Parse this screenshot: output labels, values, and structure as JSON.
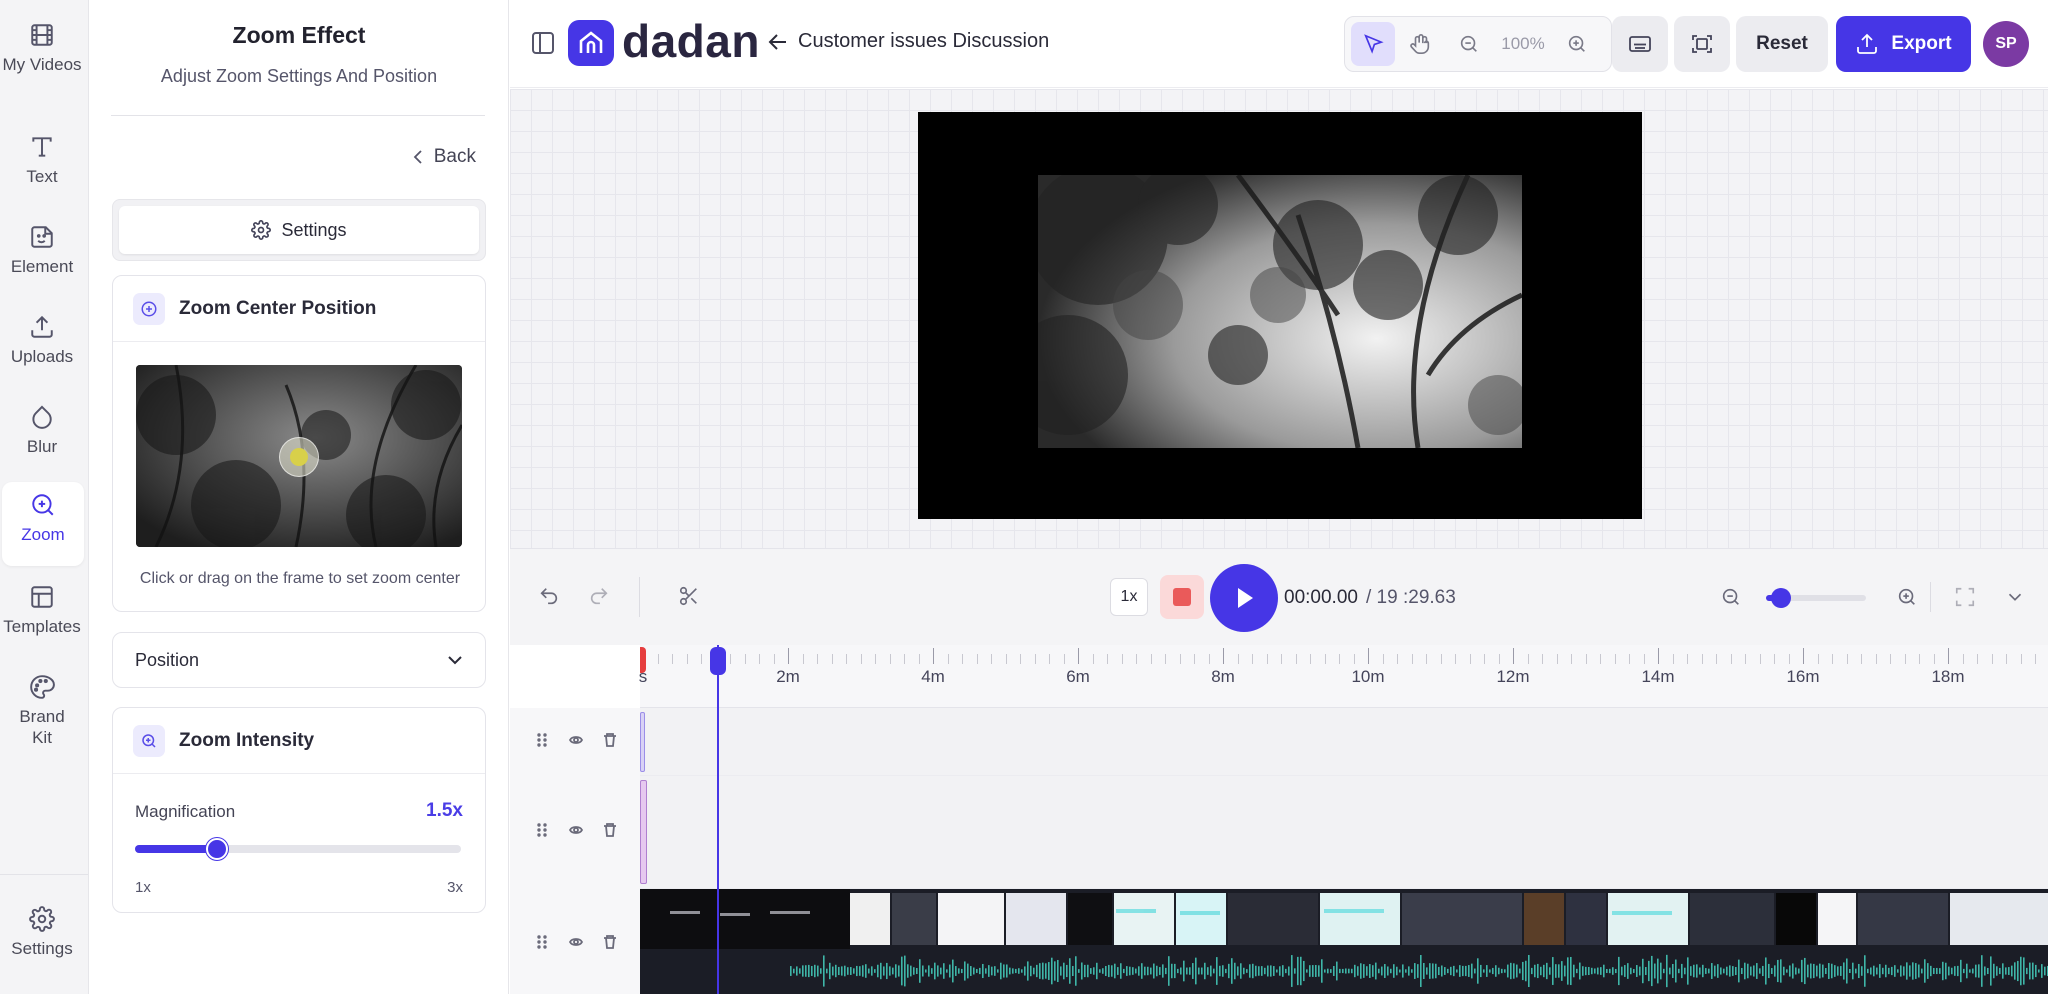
{
  "rail": {
    "items": [
      {
        "label": "My Videos",
        "icon": "film-icon"
      },
      {
        "label": "Text",
        "icon": "text-icon"
      },
      {
        "label": "Element",
        "icon": "sticker-icon"
      },
      {
        "label": "Uploads",
        "icon": "upload-icon"
      },
      {
        "label": "Blur",
        "icon": "droplet-icon"
      },
      {
        "label": "Zoom",
        "icon": "zoom-in-icon",
        "active": true
      },
      {
        "label": "Templates",
        "icon": "layout-icon"
      },
      {
        "label": "Brand Kit",
        "icon": "palette-icon"
      }
    ],
    "settings_label": "Settings"
  },
  "panel": {
    "title": "Zoom Effect",
    "subtitle": "Adjust Zoom Settings And Position",
    "back_label": "Back",
    "settings_tab": "Settings",
    "center": {
      "title": "Zoom Center Position",
      "hint": "Click or drag on the frame to set zoom center"
    },
    "position_label": "Position",
    "intensity": {
      "title": "Zoom Intensity",
      "magnification_label": "Magnification",
      "magnification_value": "1.5x",
      "magnification_fraction": 0.25,
      "min_label": "1x",
      "max_label": "3x"
    }
  },
  "header": {
    "logo_text": "dadan",
    "project_title": "Customer issues Discussion",
    "zoom_percent": "100%",
    "reset_label": "Reset",
    "export_label": "Export",
    "avatar_initials": "SP"
  },
  "player": {
    "speed": "1x",
    "current_time": "00:00.00",
    "total_time": "/ 19 :29.63",
    "timeline_zoom_fraction": 0.15
  },
  "timeline": {
    "ruler_labels": [
      "s",
      "2m",
      "4m",
      "6m",
      "8m",
      "10m",
      "12m",
      "14m",
      "16m",
      "18m"
    ]
  },
  "colors": {
    "accent": "#4636e6",
    "avatar": "#7b3aa3",
    "stop": "#ea5a5a"
  }
}
